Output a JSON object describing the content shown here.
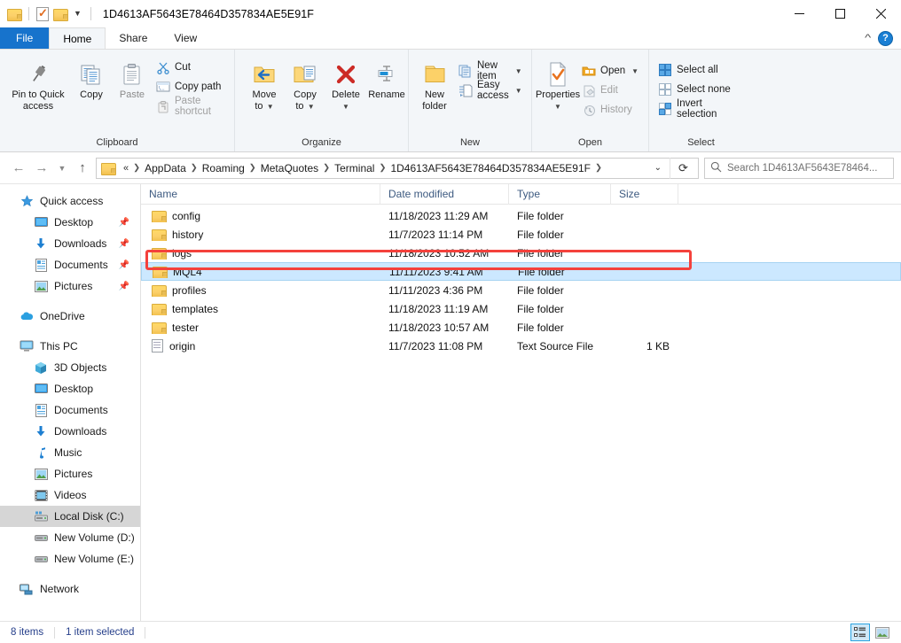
{
  "window": {
    "title": "1D4613AF5643E78464D357834AE5E91F",
    "quick_access_toolbar": [
      {
        "name": "folder-icon",
        "label": "Folder"
      },
      {
        "name": "properties-icon",
        "label": "Properties"
      },
      {
        "name": "new-folder-icon",
        "label": "New folder"
      },
      {
        "name": "customize-dropdown-icon",
        "label": "Customize Quick Access Toolbar"
      }
    ],
    "controls": {
      "minimize": "Minimize",
      "maximize": "Maximize",
      "close": "Close"
    }
  },
  "tabs": [
    {
      "label": "File",
      "id": "file",
      "active": false
    },
    {
      "label": "Home",
      "id": "home",
      "active": true
    },
    {
      "label": "Share",
      "id": "share",
      "active": false
    },
    {
      "label": "View",
      "id": "view",
      "active": false
    }
  ],
  "tabrow_right": {
    "collapse_label": "Collapse the Ribbon",
    "help_label": "?"
  },
  "ribbon": {
    "groups": [
      {
        "label": "Clipboard",
        "big_buttons": [
          {
            "name": "pin-to-quick-access-button",
            "label_line1": "Pin to Quick",
            "label_line2": "access",
            "icon": "pin-icon",
            "disabled": false
          },
          {
            "name": "copy-button",
            "label_line1": "Copy",
            "label_line2": "",
            "icon": "copy-icon",
            "disabled": false
          },
          {
            "name": "paste-button",
            "label_line1": "Paste",
            "label_line2": "",
            "icon": "paste-icon",
            "disabled": true
          }
        ],
        "small_buttons": [
          {
            "name": "cut-button",
            "label": "Cut",
            "icon": "scissors-icon",
            "disabled": false
          },
          {
            "name": "copy-path-button",
            "label": "Copy path",
            "icon": "copy-path-icon",
            "disabled": false
          },
          {
            "name": "paste-shortcut-button",
            "label": "Paste shortcut",
            "icon": "paste-shortcut-icon",
            "disabled": true
          }
        ]
      },
      {
        "label": "Organize",
        "big_buttons": [
          {
            "name": "move-to-button",
            "label_line1": "Move",
            "label_line2": "to",
            "icon": "move-to-icon",
            "dropdown": true
          },
          {
            "name": "copy-to-button",
            "label_line1": "Copy",
            "label_line2": "to",
            "icon": "copy-to-icon",
            "dropdown": true
          },
          {
            "name": "delete-button",
            "label_line1": "Delete",
            "label_line2": "",
            "icon": "delete-x-icon",
            "dropdown": true
          },
          {
            "name": "rename-button",
            "label_line1": "Rename",
            "label_line2": "",
            "icon": "rename-icon",
            "dropdown": false
          }
        ],
        "small_buttons": []
      },
      {
        "label": "New",
        "big_buttons": [
          {
            "name": "new-folder-button",
            "label_line1": "New",
            "label_line2": "folder",
            "icon": "new-folder-icon",
            "dropdown": false
          }
        ],
        "small_buttons": [
          {
            "name": "new-item-button",
            "label": "New item",
            "icon": "new-item-icon",
            "dropdown": true
          },
          {
            "name": "easy-access-button",
            "label": "Easy access",
            "icon": "easy-access-icon",
            "dropdown": true
          }
        ]
      },
      {
        "label": "Open",
        "big_buttons": [
          {
            "name": "properties-button",
            "label_line1": "Properties",
            "label_line2": "",
            "icon": "properties-icon",
            "dropdown": true
          }
        ],
        "small_buttons": [
          {
            "name": "open-button",
            "label": "Open",
            "icon": "open-folder-icon",
            "dropdown": true,
            "disabled": false
          },
          {
            "name": "edit-button",
            "label": "Edit",
            "icon": "edit-icon",
            "disabled": true
          },
          {
            "name": "history-button",
            "label": "History",
            "icon": "history-icon",
            "disabled": true
          }
        ]
      },
      {
        "label": "Select",
        "big_buttons": [],
        "small_buttons": [
          {
            "name": "select-all-button",
            "label": "Select all",
            "icon": "select-all-icon",
            "disabled": false
          },
          {
            "name": "select-none-button",
            "label": "Select none",
            "icon": "select-none-icon",
            "disabled": false
          },
          {
            "name": "invert-selection-button",
            "label": "Invert selection",
            "icon": "invert-selection-icon",
            "disabled": false
          }
        ]
      }
    ]
  },
  "navigation": {
    "back_label": "Back",
    "forward_label": "Forward",
    "recent_label": "Recent locations",
    "up_label": "Up",
    "refresh_label": "Refresh",
    "overflow": "«",
    "breadcrumbs": [
      "AppData",
      "Roaming",
      "MetaQuotes",
      "Terminal",
      "1D4613AF5643E78464D357834AE5E91F"
    ],
    "dropdown_label": "Previous locations"
  },
  "search": {
    "placeholder": "Search 1D4613AF5643E78464...",
    "icon": "search-icon"
  },
  "sidebar": {
    "items": [
      {
        "label": "Quick access",
        "icon": "quick-access-star-icon",
        "level": 0,
        "pinned": false,
        "selected": false
      },
      {
        "label": "Desktop",
        "icon": "desktop-icon",
        "level": 1,
        "pinned": true,
        "selected": false
      },
      {
        "label": "Downloads",
        "icon": "downloads-icon",
        "level": 1,
        "pinned": true,
        "selected": false
      },
      {
        "label": "Documents",
        "icon": "documents-icon",
        "level": 1,
        "pinned": true,
        "selected": false
      },
      {
        "label": "Pictures",
        "icon": "pictures-icon",
        "level": 1,
        "pinned": true,
        "selected": false
      },
      {
        "label": "OneDrive",
        "icon": "onedrive-cloud-icon",
        "level": 0,
        "pinned": false,
        "selected": false
      },
      {
        "label": "This PC",
        "icon": "this-pc-icon",
        "level": 0,
        "pinned": false,
        "selected": false
      },
      {
        "label": "3D Objects",
        "icon": "3d-objects-icon",
        "level": 1,
        "pinned": false,
        "selected": false
      },
      {
        "label": "Desktop",
        "icon": "desktop-icon",
        "level": 1,
        "pinned": false,
        "selected": false
      },
      {
        "label": "Documents",
        "icon": "documents-icon",
        "level": 1,
        "pinned": false,
        "selected": false
      },
      {
        "label": "Downloads",
        "icon": "downloads-icon",
        "level": 1,
        "pinned": false,
        "selected": false
      },
      {
        "label": "Music",
        "icon": "music-note-icon",
        "level": 1,
        "pinned": false,
        "selected": false
      },
      {
        "label": "Pictures",
        "icon": "pictures-icon",
        "level": 1,
        "pinned": false,
        "selected": false
      },
      {
        "label": "Videos",
        "icon": "videos-icon",
        "level": 1,
        "pinned": false,
        "selected": false
      },
      {
        "label": "Local Disk (C:)",
        "icon": "local-disk-icon",
        "level": 1,
        "pinned": false,
        "selected": true
      },
      {
        "label": "New Volume (D:)",
        "icon": "drive-icon",
        "level": 1,
        "pinned": false,
        "selected": false
      },
      {
        "label": "New Volume (E:)",
        "icon": "drive-icon",
        "level": 1,
        "pinned": false,
        "selected": false
      },
      {
        "label": "Network",
        "icon": "network-icon",
        "level": 0,
        "pinned": false,
        "selected": false
      }
    ]
  },
  "file_list": {
    "columns": [
      {
        "label": "Name",
        "key": "name",
        "sorted": true,
        "sort_direction": "asc"
      },
      {
        "label": "Date modified",
        "key": "date",
        "sorted": false
      },
      {
        "label": "Type",
        "key": "type",
        "sorted": false
      },
      {
        "label": "Size",
        "key": "size",
        "sorted": false
      }
    ],
    "rows": [
      {
        "name": "config",
        "date": "11/18/2023 11:29 AM",
        "type": "File folder",
        "size": "",
        "icon": "folder-icon",
        "selected": false,
        "highlighted": false
      },
      {
        "name": "history",
        "date": "11/7/2023 11:14 PM",
        "type": "File folder",
        "size": "",
        "icon": "folder-icon",
        "selected": false,
        "highlighted": false
      },
      {
        "name": "logs",
        "date": "11/18/2023 10:52 AM",
        "type": "File folder",
        "size": "",
        "icon": "folder-icon",
        "selected": false,
        "highlighted": false
      },
      {
        "name": "MQL4",
        "date": "11/11/2023 9:41 AM",
        "type": "File folder",
        "size": "",
        "icon": "folder-icon",
        "selected": true,
        "highlighted": true
      },
      {
        "name": "profiles",
        "date": "11/11/2023 4:36 PM",
        "type": "File folder",
        "size": "",
        "icon": "folder-icon",
        "selected": false,
        "highlighted": false
      },
      {
        "name": "templates",
        "date": "11/18/2023 11:19 AM",
        "type": "File folder",
        "size": "",
        "icon": "folder-icon",
        "selected": false,
        "highlighted": false
      },
      {
        "name": "tester",
        "date": "11/18/2023 10:57 AM",
        "type": "File folder",
        "size": "",
        "icon": "folder-icon",
        "selected": false,
        "highlighted": false
      },
      {
        "name": "origin",
        "date": "11/7/2023 11:08 PM",
        "type": "Text Source File",
        "size": "1 KB",
        "icon": "text-file-icon",
        "selected": false,
        "highlighted": false
      }
    ]
  },
  "status_bar": {
    "item_count": "8 items",
    "selection": "1 item selected",
    "view_buttons": [
      {
        "name": "details-view-button",
        "label": "Details view",
        "active": true
      },
      {
        "name": "large-icons-view-button",
        "label": "Large icons view",
        "active": false
      }
    ]
  },
  "colors": {
    "accent_blue": "#1773cc",
    "selection_blue": "#cce8ff",
    "highlight_red": "#f4413c",
    "folder_yellow": "#ffd966",
    "column_header_text": "#3d5a80",
    "status_text": "#27408b"
  }
}
